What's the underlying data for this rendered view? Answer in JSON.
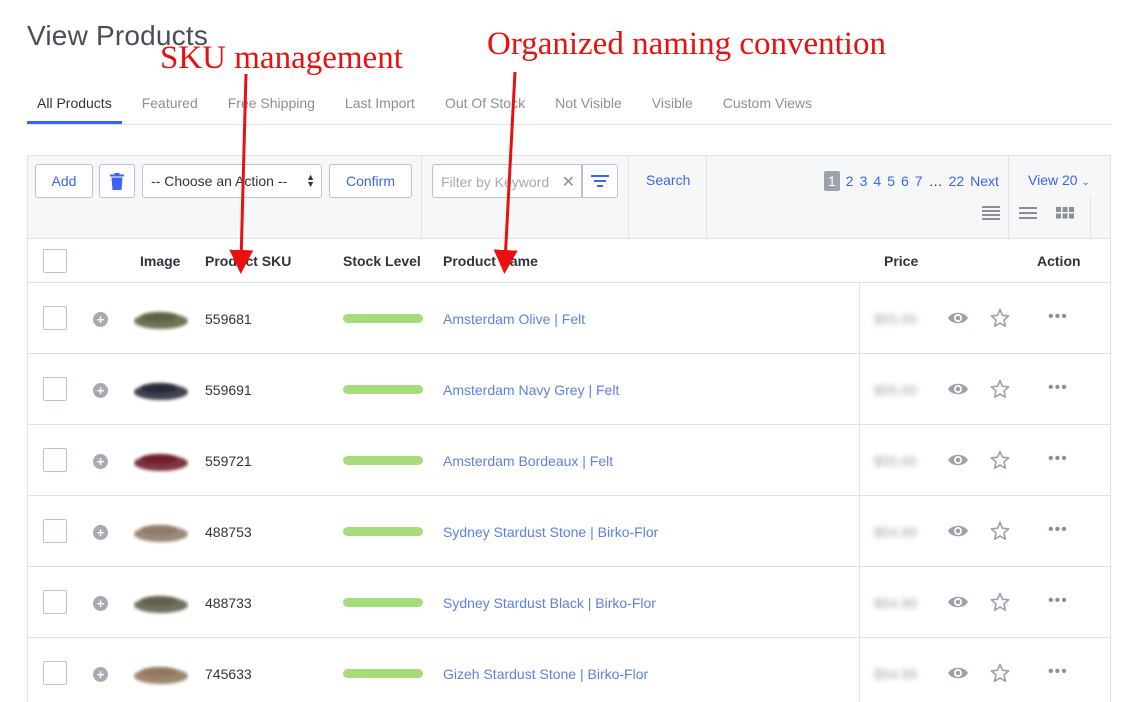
{
  "page": {
    "title": "View Products"
  },
  "annotations": {
    "sku": "SKU management",
    "name": "Organized naming convention",
    "color": "#e8110f"
  },
  "tabs": [
    "All Products",
    "Featured",
    "Free Shipping",
    "Last Import",
    "Out Of Stock",
    "Not Visible",
    "Visible",
    "Custom Views"
  ],
  "toolbar": {
    "add_label": "Add",
    "action_select": "-- Choose an Action --",
    "confirm_label": "Confirm",
    "filter_placeholder": "Filter by Keyword",
    "search_label": "Search",
    "view_label": "View 20"
  },
  "pagination": {
    "pages": [
      "1",
      "2",
      "3",
      "4",
      "5",
      "6",
      "7"
    ],
    "current": "1",
    "ellipsis": "…",
    "last": "22",
    "next": "Next"
  },
  "columns": {
    "image": "Image",
    "sku": "Product SKU",
    "stock": "Stock Level",
    "name": "Product Name",
    "price": "Price",
    "action": "Action"
  },
  "rows": [
    {
      "sku": "559681",
      "name": "Amsterdam Olive | Felt",
      "price": "$55.00",
      "stock_level": 1.0,
      "color": "#5a5a3a"
    },
    {
      "sku": "559691",
      "name": "Amsterdam Navy Grey | Felt",
      "price": "$55.00",
      "stock_level": 1.0,
      "color": "#1d2233"
    },
    {
      "sku": "559721",
      "name": "Amsterdam Bordeaux | Felt",
      "price": "$55.00",
      "stock_level": 1.0,
      "color": "#6a1420"
    },
    {
      "sku": "488753",
      "name": "Sydney Stardust Stone | Birko-Flor",
      "price": "$54.99",
      "stock_level": 1.0,
      "color": "#8a7560"
    },
    {
      "sku": "488733",
      "name": "Sydney Stardust Black | Birko-Flor",
      "price": "$54.99",
      "stock_level": 1.0,
      "color": "#5d5646"
    },
    {
      "sku": "745633",
      "name": "Gizeh Stardust Stone | Birko-Flor",
      "price": "$54.99",
      "stock_level": 1.0,
      "color": "#8d7155"
    }
  ],
  "colors": {
    "accent": "#3c64f4",
    "link": "#5e81e0",
    "stock": "#a7dc7a"
  },
  "icons": [
    "trash-icon",
    "filter-icon",
    "eye-icon",
    "star-icon",
    "more-icon",
    "plus-circle-icon",
    "list-view-icon",
    "grid-view-icon"
  ]
}
